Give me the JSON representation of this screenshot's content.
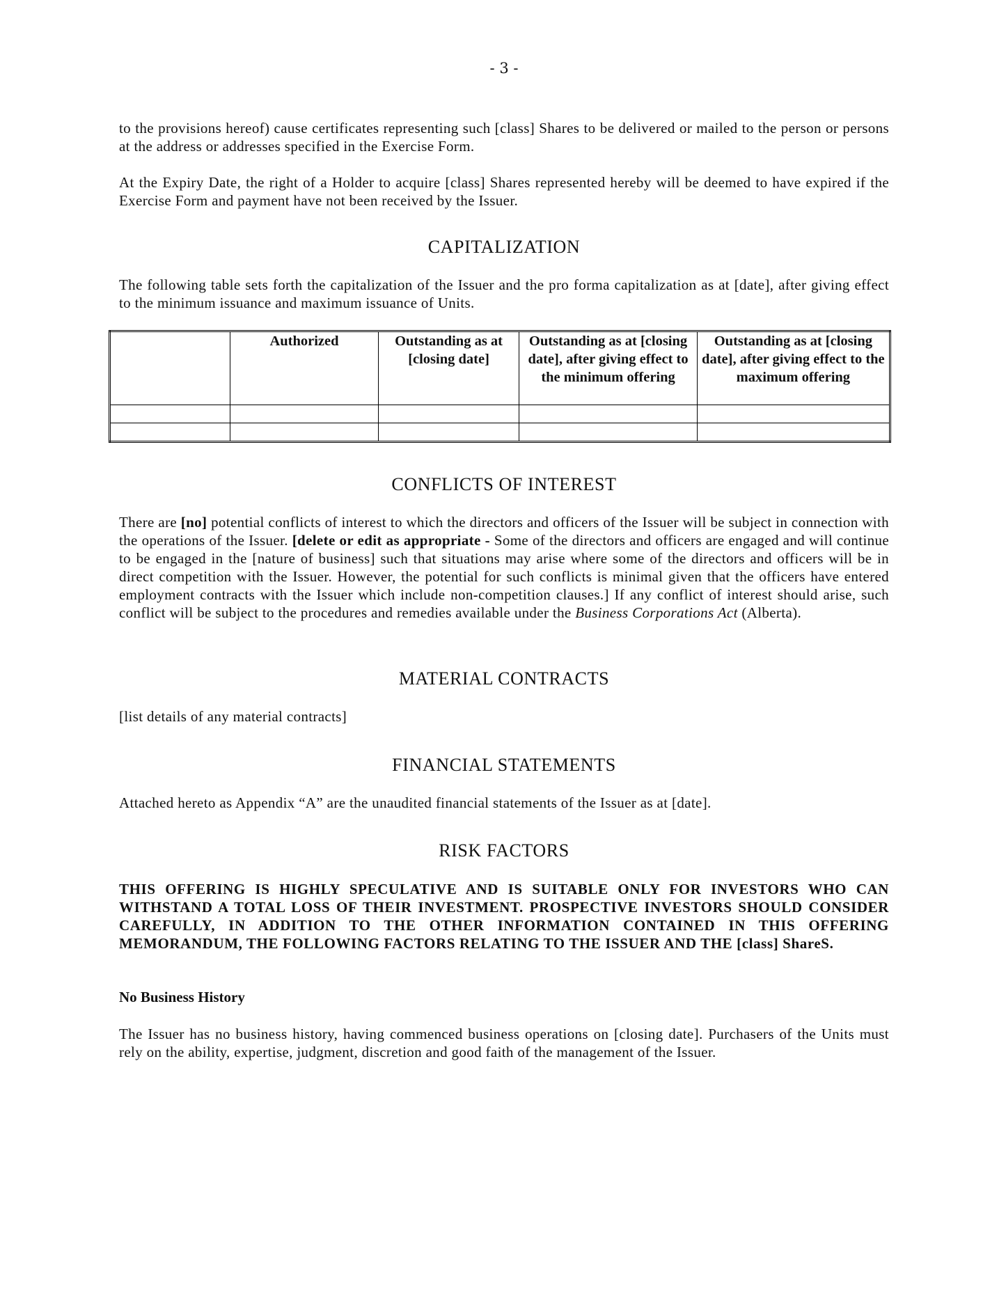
{
  "page_number": "- 3 -",
  "paragraphs": {
    "p1": "to the provisions hereof) cause certificates representing such [class] Shares to be delivered or mailed to the person or persons at the address or addresses specified in the Exercise Form.",
    "p2": "At the Expiry Date, the right of a Holder to acquire [class] Shares represented hereby will be deemed to have expired if the Exercise Form and payment have not been received by the Issuer."
  },
  "capitalization": {
    "heading": "CAPITALIZATION",
    "intro": "The following table sets forth the capitalization of the Issuer and the pro forma capitalization as at [date], after giving effect to the minimum issuance and maximum issuance of Units.",
    "table": {
      "headers": [
        "",
        "Authorized",
        "Outstanding as at [closing date]",
        "Outstanding as at [closing date], after giving effect to the minimum offering",
        "Outstanding as at [closing date], after giving effect to the maximum offering"
      ],
      "rows": [
        [
          "",
          "",
          "",
          "",
          ""
        ],
        [
          "",
          "",
          "",
          "",
          ""
        ]
      ]
    }
  },
  "conflicts": {
    "heading": "CONFLICTS OF INTEREST",
    "t1": "There are ",
    "t2_bold": "[no]",
    "t3": " potential conflicts of interest to which the directors and officers of the Issuer will be subject in connection with the operations of the Issuer. ",
    "t4_bold": "[delete or edit as appropriate -",
    "t5": " Some of the directors and officers are engaged and will continue to be engaged in the [nature of business] such that situations may arise where some of the directors and officers will be in direct competition with the Issuer. However, the potential for such conflicts is minimal given that the officers have entered employment contracts with the Issuer which include non-competition clauses.] If any conflict of interest should arise, such conflict will be subject to the procedures and remedies available under the ",
    "t6_italic": "Business Corporations Act",
    "t7": " (Alberta)."
  },
  "material_contracts": {
    "heading": "MATERIAL CONTRACTS",
    "body": "[list details of any material contracts]"
  },
  "financial_statements": {
    "heading": "FINANCIAL STATEMENTS",
    "body": "Attached hereto as Appendix “A” are the unaudited financial statements of the Issuer as at [date]."
  },
  "risk_factors": {
    "heading": "RISK FACTORS",
    "warning": "THIS OFFERING IS HIGHLY SPECULATIVE AND IS SUITABLE ONLY FOR INVESTORS WHO CAN WITHSTAND A TOTAL LOSS OF THEIR INVESTMENT. PROSPECTIVE INVESTORS SHOULD CONSIDER CAREFULLY, IN ADDITION TO THE OTHER INFORMATION CONTAINED IN THIS OFFERING MEMORANDUM, THE FOLLOWING FACTORS RELATING TO THE ISSUER AND THE [class] ShareS.",
    "subheading": "No Business History",
    "body": "The Issuer has no business history, having commenced business operations on [closing date]. Purchasers of the Units must rely on the ability, expertise, judgment, discretion and good faith of the management of the Issuer."
  }
}
